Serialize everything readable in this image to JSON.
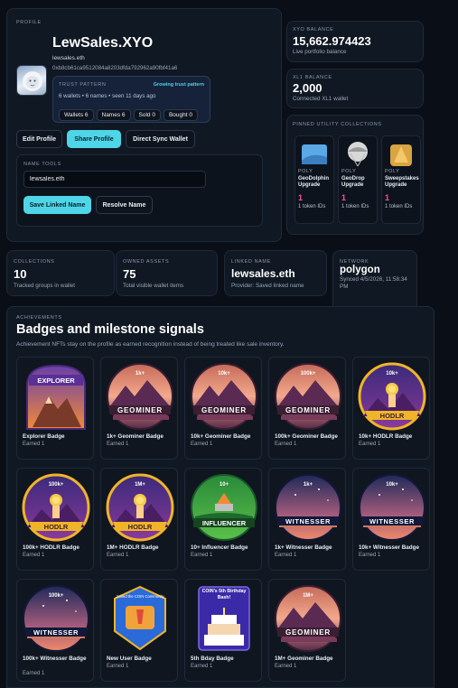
{
  "profile": {
    "section_label": "PROFILE",
    "name": "LewSales.XYO",
    "ens": "lewsales.eth",
    "address": "0xb8cb61ca9512084a8203dfda792962a90fbf41a6",
    "trust": {
      "label": "TRUST PATTERN",
      "status": "Growing trust pattern",
      "summary": "6 wallets • 6 names • seen 11 days ago",
      "chips": [
        "Wallets 6",
        "Names 6",
        "Sold 0",
        "Bought 0"
      ]
    },
    "buttons": {
      "edit": "Edit Profile",
      "share": "Share Profile",
      "sync": "Direct Sync Wallet"
    },
    "name_tools": {
      "label": "NAME TOOLS",
      "input_value": "lewsales.eth",
      "save": "Save Linked Name",
      "resolve": "Resolve Name"
    }
  },
  "xyo": {
    "label": "XYO BALANCE",
    "value": "15,662.974423",
    "sub": "Live portfolio balance"
  },
  "xl1": {
    "label": "XL1 BALANCE",
    "value": "2,000",
    "sub": "Connected XL1 wallet"
  },
  "pinned": {
    "label": "PINNED UTILITY COLLECTIONS",
    "items": [
      {
        "chain": "POLY",
        "title": "GeoDolphin Upgrade",
        "count": "1",
        "ids": "1 token IDs",
        "color": "#5aa9e6"
      },
      {
        "chain": "POLY",
        "title": "GeoDrop Upgrade",
        "count": "1",
        "ids": "1 token IDs",
        "color": "#c8c8c8"
      },
      {
        "chain": "POLY",
        "title": "Sweepstakes Upgrade",
        "count": "1",
        "ids": "1 token IDs",
        "color": "#d9a441"
      }
    ]
  },
  "stats": {
    "collections": {
      "label": "COLLECTIONS",
      "value": "10",
      "sub": "Tracked groups in wallet"
    },
    "owned": {
      "label": "OWNED ASSETS",
      "value": "75",
      "sub": "Total visible wallet items"
    },
    "linked": {
      "label": "LINKED NAME",
      "value": "lewsales.eth",
      "sub": "Provider: Saved linked name"
    },
    "network": {
      "label": "NETWORK",
      "value": "polygon",
      "sub": "Synced 4/5/2026, 11:58:34 PM"
    }
  },
  "achievements": {
    "label": "ACHIEVEMENTS",
    "title": "Badges and milestone signals",
    "subtitle": "Achievement NFTs stay on the profile as earned recognition instead of being treated like sale inventory.",
    "badges": [
      {
        "name": "Explorer Badge",
        "earned": "Earned 1",
        "kind": "explorer",
        "tier": "",
        "text": "EXPLORER"
      },
      {
        "name": "1k+ Geominer Badge",
        "earned": "Earned 1",
        "kind": "geominer",
        "tier": "1k+",
        "text": "GEOMINER"
      },
      {
        "name": "10k+ Geominer Badge",
        "earned": "Earned 1",
        "kind": "geominer",
        "tier": "10k+",
        "text": "GEOMINER"
      },
      {
        "name": "100k+ Geominer Badge",
        "earned": "Earned 1",
        "kind": "geominer",
        "tier": "100k+",
        "text": "GEOMINER"
      },
      {
        "name": "10k+ HODLR Badge",
        "earned": "Earned 1",
        "kind": "hodlr",
        "tier": "10k+",
        "text": "HODLR"
      },
      {
        "name": "100k+ HODLR Badge",
        "earned": "Earned 1",
        "kind": "hodlr",
        "tier": "100k+",
        "text": "HODLR"
      },
      {
        "name": "1M+ HODLR Badge",
        "earned": "Earned 1",
        "kind": "hodlr",
        "tier": "1M+",
        "text": "HODLR"
      },
      {
        "name": "10+ Influencer Badge",
        "earned": "Earned 1",
        "kind": "influencer",
        "tier": "10+",
        "text": "INFLUENCER"
      },
      {
        "name": "1k+ Witnesser Badge",
        "earned": "Earned 1",
        "kind": "witnesser",
        "tier": "1k+",
        "text": "WITNESSER"
      },
      {
        "name": "10k+ Witnesser Badge",
        "earned": "Earned 1",
        "kind": "witnesser",
        "tier": "10k+",
        "text": "WITNESSER"
      },
      {
        "name": "100k+ Witnesser Badge",
        "earned": "Earned 1",
        "kind": "witnesser",
        "tier": "100k+",
        "text": "WITNESSER"
      },
      {
        "name": "New User Badge",
        "earned": "Earned 1",
        "kind": "newuser",
        "tier": "",
        "text": "Joined the COIN Community"
      },
      {
        "name": "5th Bday Badge",
        "earned": "Earned 1",
        "kind": "bday",
        "tier": "",
        "text": "COIN's 5th Birthday Bash!"
      },
      {
        "name": "1M+ Geominer Badge",
        "earned": "Earned 1",
        "kind": "geominer",
        "tier": "1M+",
        "text": "GEOMINER"
      }
    ]
  }
}
